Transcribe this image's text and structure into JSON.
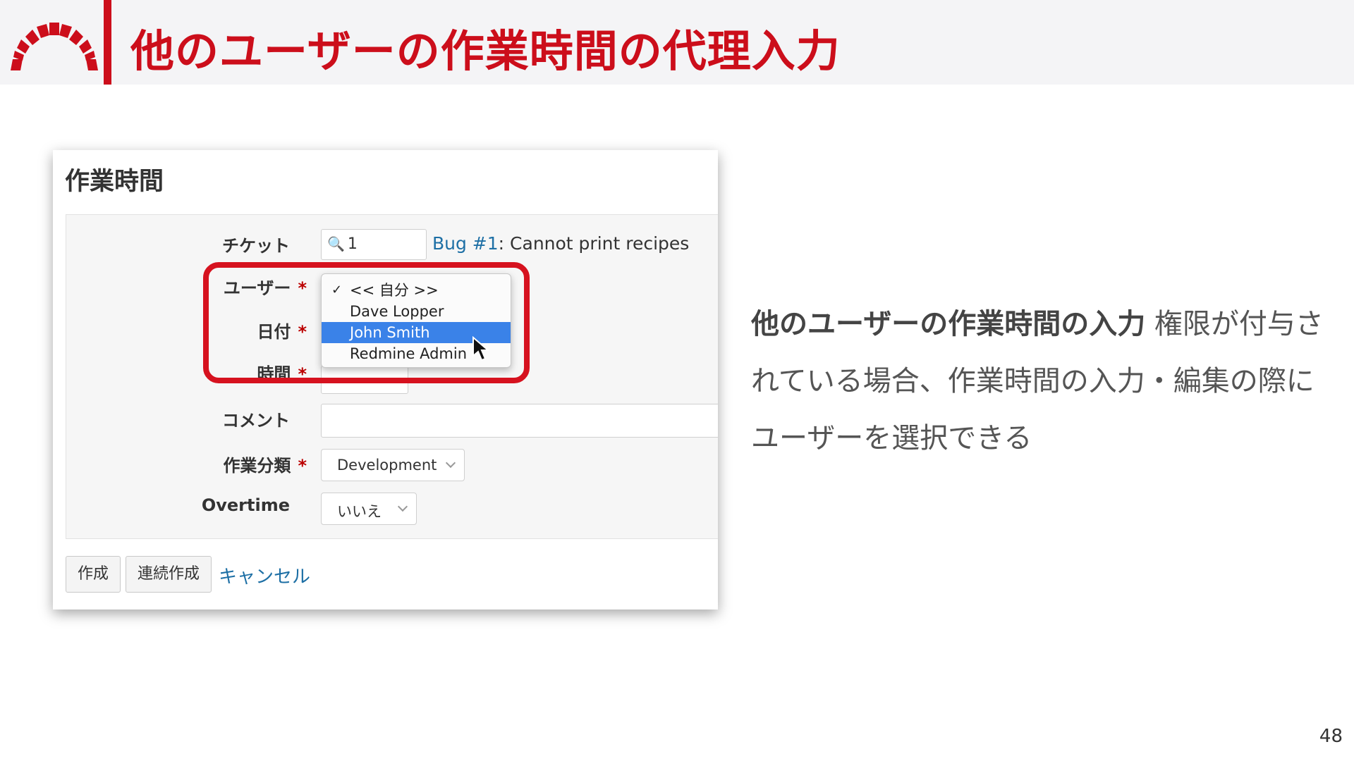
{
  "slide": {
    "title": "他のユーザーの作業時間の代理入力",
    "page_number": "48",
    "accent_color": "#cc0e1b"
  },
  "panel": {
    "title": "作業時間",
    "fields": {
      "ticket_label": "チケット",
      "ticket_value": "1",
      "ticket_link_text": "Bug #1",
      "ticket_subject": ": Cannot print recipes",
      "user_label": "ユーザー",
      "date_label": "日付",
      "hours_label": "時間",
      "comment_label": "コメント",
      "activity_label": "作業分類",
      "activity_value": "Development",
      "overtime_label": "Overtime",
      "overtime_value": "いいえ",
      "required_mark": "*"
    },
    "user_dropdown": {
      "options": [
        "<< 自分 >>",
        "Dave Lopper",
        "John Smith",
        "Redmine Admin"
      ],
      "checked": "<< 自分 >>",
      "highlighted": "John Smith"
    },
    "buttons": {
      "create": "作成",
      "create_continue": "連続作成",
      "cancel": "キャンセル"
    }
  },
  "description": {
    "strong": "他のユーザーの作業時間の入力",
    "rest": " 権限が付与されている場合、作業時間の入力・編集の際にユーザーを選択できる"
  }
}
